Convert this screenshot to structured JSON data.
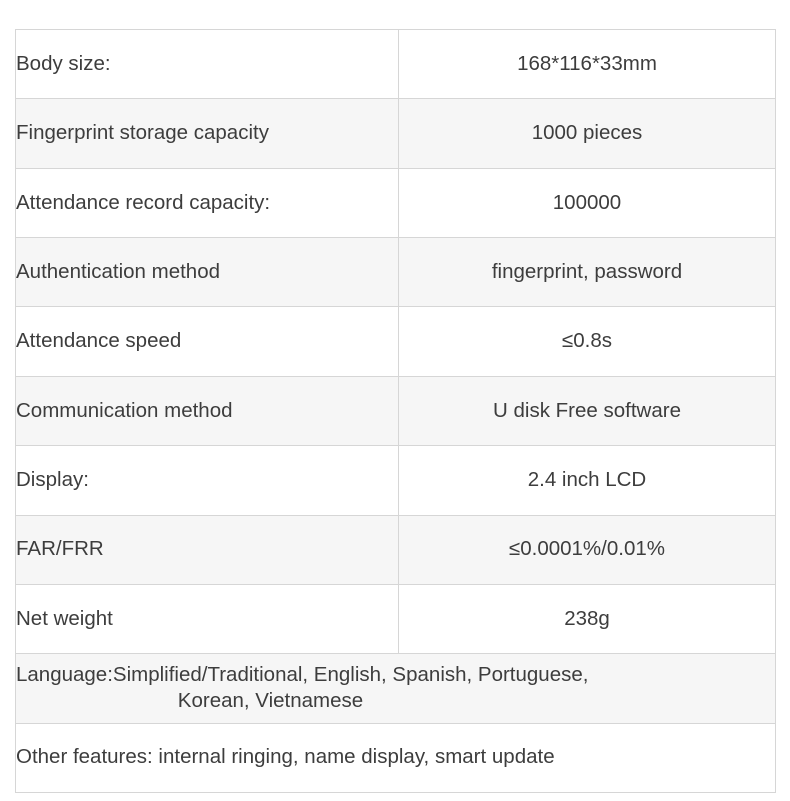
{
  "table": {
    "colors": {
      "border": "#d6d6d6",
      "text": "#3d3d3d",
      "row_shaded_bg": "#f6f6f6",
      "row_plain_bg": "#ffffff"
    },
    "rows": [
      {
        "label": "Body size:",
        "value": "168*116*33mm"
      },
      {
        "label": "Fingerprint storage capacity",
        "value": "1000 pieces"
      },
      {
        "label": "Attendance record capacity:",
        "value": "100000"
      },
      {
        "label": "Authentication method",
        "value": "fingerprint, password"
      },
      {
        "label": "Attendance speed",
        "value": "≤0.8s"
      },
      {
        "label": "Communication method",
        "value": "U disk Free software"
      },
      {
        "label": "Display:",
        "value": "2.4 inch LCD"
      },
      {
        "label": "FAR/FRR",
        "value": "≤0.0001%/0.01%"
      },
      {
        "label": "Net weight",
        "value": "238g"
      }
    ],
    "language_row": {
      "line1": "Language:Simplified/Traditional, English, Spanish, Portuguese,",
      "line2": "Korean, Vietnamese"
    },
    "features_row": {
      "text": "Other features: internal ringing, name display, smart update"
    }
  }
}
